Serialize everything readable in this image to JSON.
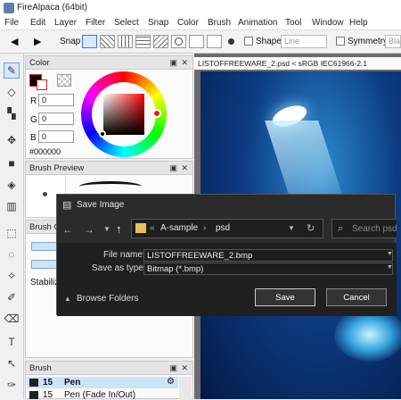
{
  "app": {
    "title": "FireAlpaca (64bit)"
  },
  "menu": [
    "File",
    "Edit",
    "Layer",
    "Filter",
    "Select",
    "Snap",
    "Color",
    "Brush",
    "Animation",
    "Tool",
    "Window",
    "Help"
  ],
  "toolbar": {
    "snap_label": "Snap",
    "shape_label": "Shape",
    "shape_value": "Line",
    "symmetry_label": "Symmetry",
    "symmetry_value": "Bla"
  },
  "color_panel": {
    "title": "Color",
    "r_label": "R",
    "r_value": "0",
    "g_label": "G",
    "g_value": "0",
    "b_label": "B",
    "b_value": "0",
    "hex": "#000000"
  },
  "brush_preview": {
    "title": "Brush Preview"
  },
  "brush_control": {
    "title": "Brush Co",
    "stabilizer_label": "Stabilize"
  },
  "brush_list": {
    "title": "Brush",
    "items": [
      {
        "size": "15",
        "name": "Pen"
      },
      {
        "size": "15",
        "name": "Pen (Fade In/Out)"
      }
    ]
  },
  "document": {
    "title": "LISTOFFREEWARE_2.psd < sRGB IEC61966-2.1"
  },
  "dialog": {
    "title": "Save Image",
    "path": [
      "«",
      "A-sample",
      "›",
      "psd"
    ],
    "search_placeholder": "Search psd",
    "filename_label": "File name:",
    "filename_value": "LISTOFFREEWARE_2.bmp",
    "type_label": "Save as type:",
    "type_value": "Bitmap (*.bmp)",
    "browse_label": "Browse Folders",
    "save_label": "Save",
    "cancel_label": "Cancel"
  },
  "colors": {
    "accent": "#e02020",
    "dialog_bg": "#2b2b2b",
    "canvas_blue": "#0c3c82"
  }
}
